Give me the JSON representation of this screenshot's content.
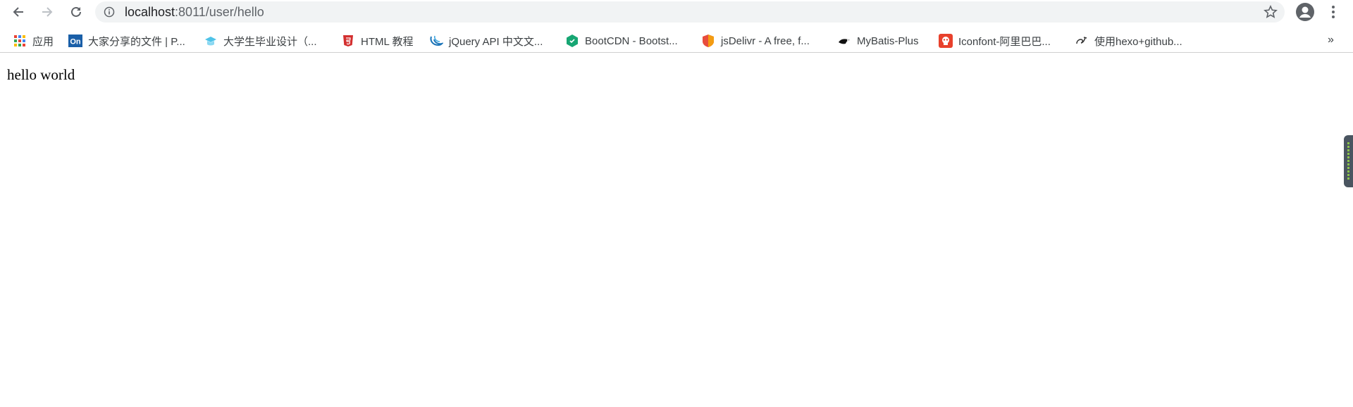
{
  "browser": {
    "url_host": "localhost",
    "url_path": ":8011/user/hello",
    "colors": {
      "omnibox_bg": "#f1f3f4",
      "icon": "#5f6368"
    }
  },
  "bookmarks": [
    {
      "label": "应用",
      "icon": "apps-grid-icon"
    },
    {
      "label": "大家分享的文件 | P...",
      "icon": "on-logo-icon"
    },
    {
      "label": "大学生毕业设计（...",
      "icon": "graduation-icon"
    },
    {
      "label": "HTML 教程",
      "icon": "html5-icon"
    },
    {
      "label": "jQuery API 中文文...",
      "icon": "jquery-icon"
    },
    {
      "label": "BootCDN - Bootst...",
      "icon": "bootcdn-icon"
    },
    {
      "label": "jsDelivr - A free, f...",
      "icon": "jsdelivr-icon"
    },
    {
      "label": "MyBatis-Plus",
      "icon": "bird-icon"
    },
    {
      "label": "Iconfont-阿里巴巴...",
      "icon": "iconfont-icon"
    },
    {
      "label": "使用hexo+github...",
      "icon": "hexo-icon"
    }
  ],
  "bookmarks_overflow": "»",
  "page": {
    "text": "hello world"
  }
}
